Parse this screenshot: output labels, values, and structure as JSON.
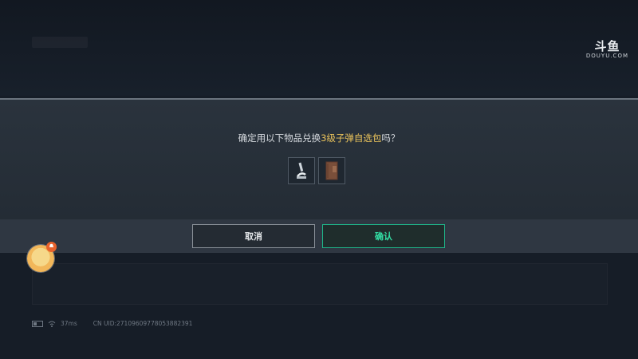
{
  "watermark": {
    "main": "斗鱼",
    "sub": "DOUYU.COM"
  },
  "dialog": {
    "prompt_prefix": "确定用以下物品兑换",
    "prompt_highlight": "3级子弹自选包",
    "prompt_suffix": "吗？",
    "items": [
      {
        "icon": "microscope-icon"
      },
      {
        "icon": "leather-book-icon"
      }
    ],
    "cancel_label": "取消",
    "confirm_label": "确认"
  },
  "avatar": {
    "badge": ""
  },
  "status": {
    "ping": "37ms",
    "uid": "CN UID:271096097780538823​91"
  },
  "colors": {
    "accent": "#1fb68a",
    "highlight": "#e9c25b",
    "background": "#161d27"
  }
}
